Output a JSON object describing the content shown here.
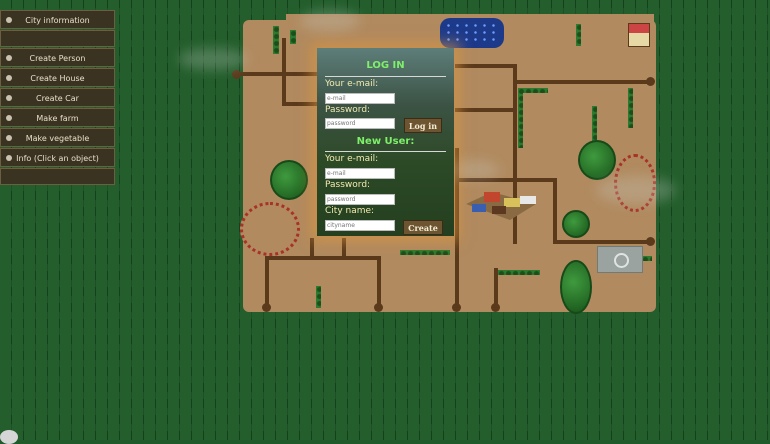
{
  "sidebar": {
    "items": [
      {
        "label": "City information"
      },
      {
        "label": "Create Person"
      },
      {
        "label": "Create House"
      },
      {
        "label": "Create Car"
      },
      {
        "label": "Make farm"
      },
      {
        "label": "Make vegetable"
      },
      {
        "label": "Info (Click an object)"
      }
    ]
  },
  "login": {
    "title": "LOG IN",
    "email_label": "Your e-mail:",
    "email_placeholder": "e-mail",
    "password_label": "Password:",
    "password_placeholder": "password",
    "login_button": "Log in",
    "new_user_title": "New User:",
    "new_email_label": "Your e-mail:",
    "new_email_placeholder": "e-mail",
    "new_password_label": "Password:",
    "new_password_placeholder": "password",
    "city_label": "City name:",
    "city_placeholder": "cityname",
    "create_button": "Create"
  },
  "colors": {
    "grass": "#235e2c",
    "dirt": "#b18a5f",
    "road": "#5b3a1c",
    "panel_title": "#7ef06a",
    "panel_label": "#f2eab0",
    "button": "#6e5531"
  }
}
